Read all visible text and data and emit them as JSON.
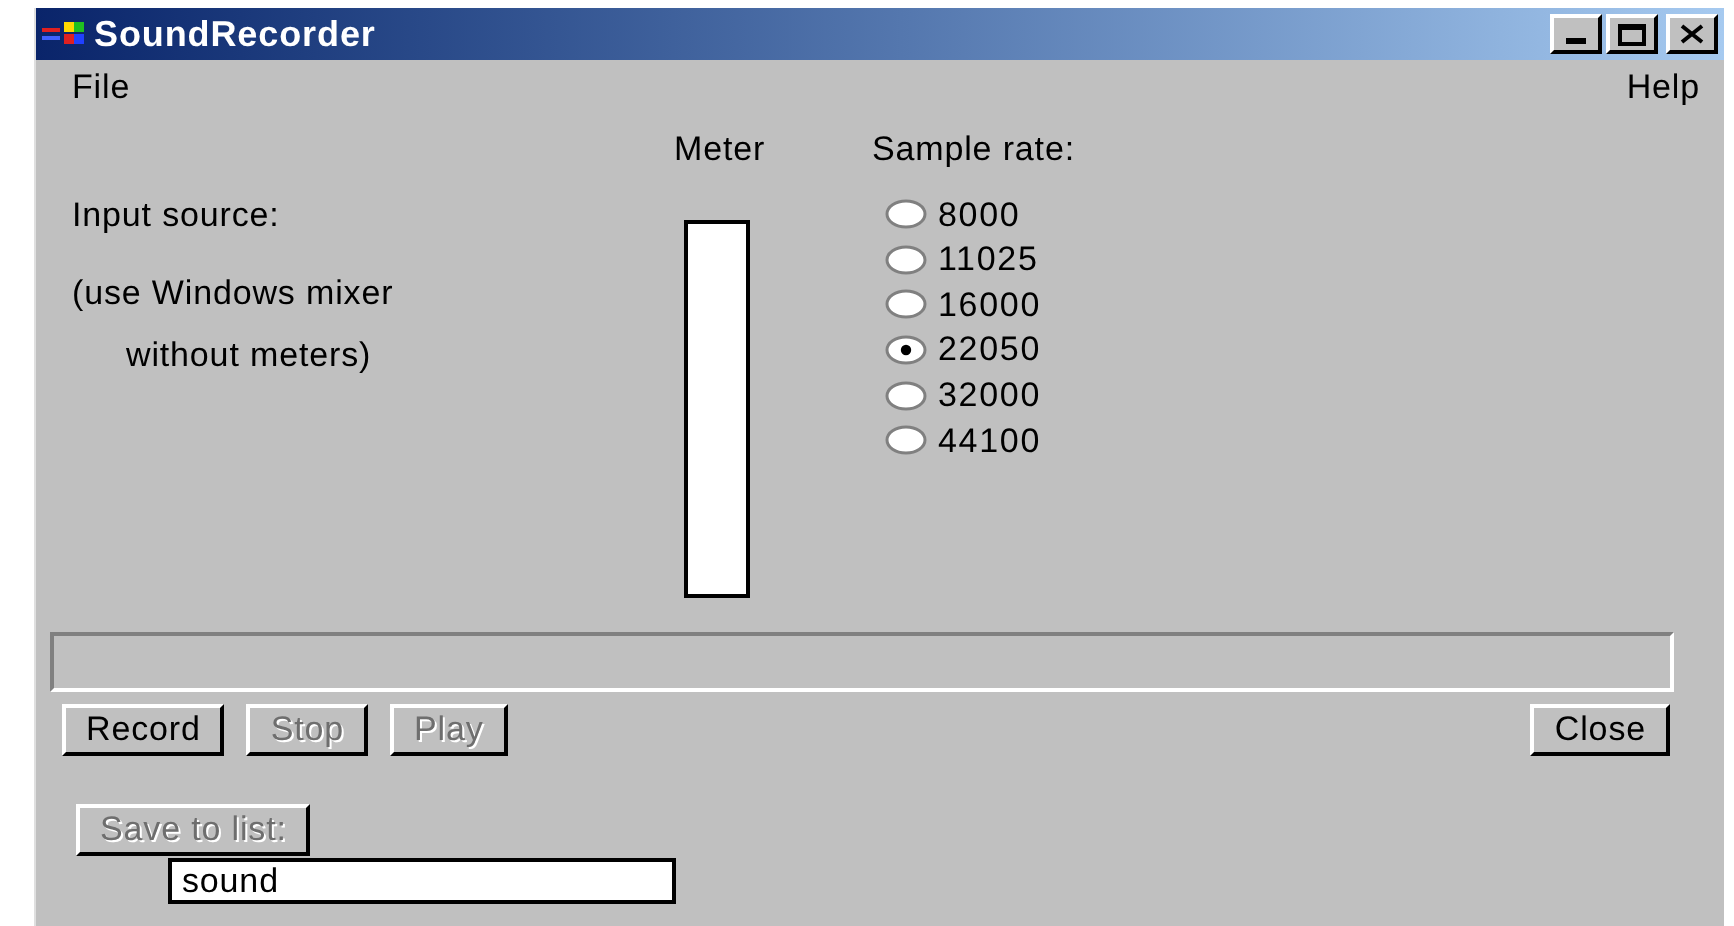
{
  "window": {
    "title": "SoundRecorder"
  },
  "menu": [
    "File",
    "Help"
  ],
  "input_source": {
    "label": "Input source:",
    "note_line_1": "(use Windows mixer",
    "note_line_2": "without meters)"
  },
  "meter": {
    "label": "Meter"
  },
  "sample_rate": {
    "label": "Sample rate:",
    "options": [
      {
        "label": "8000",
        "selected": false
      },
      {
        "label": "11025",
        "selected": false
      },
      {
        "label": "16000",
        "selected": false
      },
      {
        "label": "22050",
        "selected": true
      },
      {
        "label": "32000",
        "selected": false
      },
      {
        "label": "44100",
        "selected": false
      }
    ]
  },
  "buttons": [
    {
      "label": "Record",
      "disabled": false
    },
    {
      "label": "Stop",
      "disabled": true
    },
    {
      "label": "Play",
      "disabled": true
    }
  ],
  "close_button": {
    "label": "Close",
    "disabled": false
  },
  "save_button": {
    "label": "Save to list:",
    "disabled": true
  },
  "name_field": {
    "value": "sound"
  }
}
